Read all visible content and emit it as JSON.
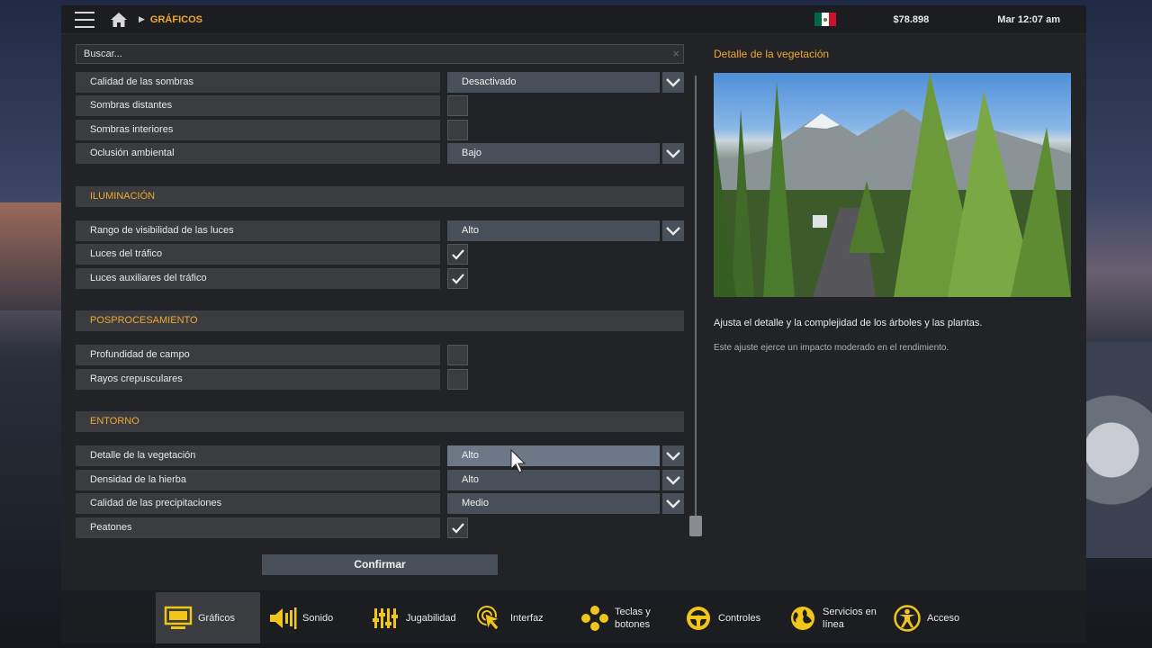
{
  "topbar": {
    "breadcrumb": "GRÁFICOS",
    "money": "$78.898",
    "time": "Mar 12:07 am",
    "flag_colors": [
      "#006847",
      "#ffffff",
      "#ce1126"
    ]
  },
  "search": {
    "placeholder": "Buscar..."
  },
  "settings": {
    "calidad_sombras": {
      "label": "Calidad de las sombras",
      "value": "Desactivado"
    },
    "sombras_distantes": {
      "label": "Sombras distantes",
      "checked": false
    },
    "sombras_interiores": {
      "label": "Sombras interiores",
      "checked": false
    },
    "oclusion": {
      "label": "Oclusión ambiental",
      "value": "Bajo"
    },
    "sec_iluminacion": "ILUMINACIÓN",
    "rango_luces": {
      "label": "Rango de visibilidad de las luces",
      "value": "Alto"
    },
    "luces_trafico": {
      "label": "Luces del tráfico",
      "checked": true
    },
    "luces_aux": {
      "label": "Luces auxiliares del tráfico",
      "checked": true
    },
    "sec_posprocesamiento": "POSPROCESAMIENTO",
    "profundidad": {
      "label": "Profundidad de campo",
      "checked": false
    },
    "rayos": {
      "label": "Rayos crepusculares",
      "checked": false
    },
    "sec_entorno": "ENTORNO",
    "vegetacion": {
      "label": "Detalle de la vegetación",
      "value": "Alto"
    },
    "hierba": {
      "label": "Densidad de la hierba",
      "value": "Alto"
    },
    "precipitaciones": {
      "label": "Calidad de las precipitaciones",
      "value": "Medio"
    },
    "peatones": {
      "label": "Peatones",
      "checked": true
    }
  },
  "confirm_label": "Confirmar",
  "detail": {
    "title": "Detalle de la vegetación",
    "description": "Ajusta el detalle y la complejidad de los árboles y las plantas.",
    "note": "Este ajuste ejerce un impacto moderado en el rendimiento."
  },
  "tabs": [
    {
      "label": "Gráficos",
      "icon": "monitor-icon",
      "active": true
    },
    {
      "label": "Sonido",
      "icon": "speaker-icon"
    },
    {
      "label": "Jugabilidad",
      "icon": "sliders-icon"
    },
    {
      "label": "Interfaz",
      "icon": "cursor-icon"
    },
    {
      "label": "Teclas y botones",
      "icon": "gamepad-buttons-icon"
    },
    {
      "label": "Controles",
      "icon": "steering-wheel-icon"
    },
    {
      "label": "Servicios en línea",
      "icon": "globe-icon"
    },
    {
      "label": "Acceso",
      "icon": "accessibility-icon"
    }
  ],
  "colors": {
    "accent": "#f0a830",
    "icon_yellow": "#f2c618"
  }
}
